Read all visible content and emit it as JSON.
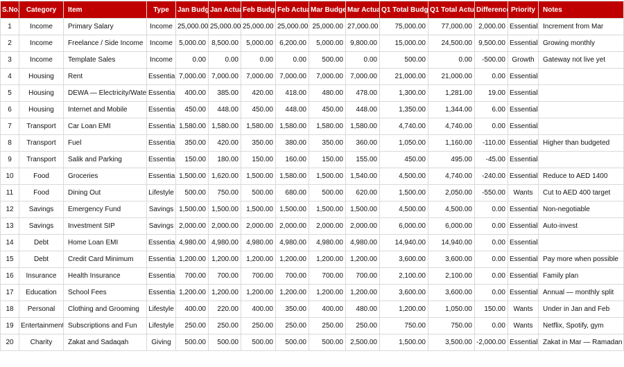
{
  "colors": {
    "header_bg": "#c00000",
    "header_text": "#ffffff",
    "grid": "#d9d9d9"
  },
  "columns": [
    {
      "key": "sno",
      "label": "S.No.",
      "align": "c"
    },
    {
      "key": "category",
      "label": "Category",
      "align": "c"
    },
    {
      "key": "item",
      "label": "Item",
      "align": "l"
    },
    {
      "key": "type",
      "label": "Type",
      "align": "c"
    },
    {
      "key": "jan_budget",
      "label": "Jan Budget",
      "align": "r"
    },
    {
      "key": "jan_actual",
      "label": "Jan Actual",
      "align": "r"
    },
    {
      "key": "feb_budget",
      "label": "Feb Budget",
      "align": "r"
    },
    {
      "key": "feb_actual",
      "label": "Feb Actual",
      "align": "r"
    },
    {
      "key": "mar_budget",
      "label": "Mar Budget",
      "align": "r"
    },
    {
      "key": "mar_actual",
      "label": "Mar Actual",
      "align": "r"
    },
    {
      "key": "q1_budget",
      "label": "Q1 Total Budget",
      "align": "r"
    },
    {
      "key": "q1_actual",
      "label": "Q1 Total Actual",
      "align": "r"
    },
    {
      "key": "difference",
      "label": "Difference",
      "align": "r"
    },
    {
      "key": "priority",
      "label": "Priority",
      "align": "c"
    },
    {
      "key": "notes",
      "label": "Notes",
      "align": "l"
    }
  ],
  "rows": [
    [
      "1",
      "Income",
      "Primary Salary",
      "Income",
      "25,000.00",
      "25,000.00",
      "25,000.00",
      "25,000.00",
      "25,000.00",
      "27,000.00",
      "75,000.00",
      "77,000.00",
      "2,000.00",
      "Essential",
      "Increment from Mar"
    ],
    [
      "2",
      "Income",
      "Freelance / Side Income",
      "Income",
      "5,000.00",
      "8,500.00",
      "5,000.00",
      "6,200.00",
      "5,000.00",
      "9,800.00",
      "15,000.00",
      "24,500.00",
      "9,500.00",
      "Essential",
      "Growing monthly"
    ],
    [
      "3",
      "Income",
      "Template Sales",
      "Income",
      "0.00",
      "0.00",
      "0.00",
      "0.00",
      "500.00",
      "0.00",
      "500.00",
      "0.00",
      "-500.00",
      "Growth",
      "Gateway not live yet"
    ],
    [
      "4",
      "Housing",
      "Rent",
      "Essential",
      "7,000.00",
      "7,000.00",
      "7,000.00",
      "7,000.00",
      "7,000.00",
      "7,000.00",
      "21,000.00",
      "21,000.00",
      "0.00",
      "Essential",
      ""
    ],
    [
      "5",
      "Housing",
      "DEWA — Electricity/Water",
      "Essential",
      "400.00",
      "385.00",
      "420.00",
      "418.00",
      "480.00",
      "478.00",
      "1,300.00",
      "1,281.00",
      "19.00",
      "Essential",
      ""
    ],
    [
      "6",
      "Housing",
      "Internet and Mobile",
      "Essential",
      "450.00",
      "448.00",
      "450.00",
      "448.00",
      "450.00",
      "448.00",
      "1,350.00",
      "1,344.00",
      "6.00",
      "Essential",
      ""
    ],
    [
      "7",
      "Transport",
      "Car Loan EMI",
      "Essential",
      "1,580.00",
      "1,580.00",
      "1,580.00",
      "1,580.00",
      "1,580.00",
      "1,580.00",
      "4,740.00",
      "4,740.00",
      "0.00",
      "Essential",
      ""
    ],
    [
      "8",
      "Transport",
      "Fuel",
      "Essential",
      "350.00",
      "420.00",
      "350.00",
      "380.00",
      "350.00",
      "360.00",
      "1,050.00",
      "1,160.00",
      "-110.00",
      "Essential",
      "Higher than budgeted"
    ],
    [
      "9",
      "Transport",
      "Salik and Parking",
      "Essential",
      "150.00",
      "180.00",
      "150.00",
      "160.00",
      "150.00",
      "155.00",
      "450.00",
      "495.00",
      "-45.00",
      "Essential",
      ""
    ],
    [
      "10",
      "Food",
      "Groceries",
      "Essential",
      "1,500.00",
      "1,620.00",
      "1,500.00",
      "1,580.00",
      "1,500.00",
      "1,540.00",
      "4,500.00",
      "4,740.00",
      "-240.00",
      "Essential",
      "Reduce to AED 1400"
    ],
    [
      "11",
      "Food",
      "Dining Out",
      "Lifestyle",
      "500.00",
      "750.00",
      "500.00",
      "680.00",
      "500.00",
      "620.00",
      "1,500.00",
      "2,050.00",
      "-550.00",
      "Wants",
      "Cut to AED 400 target"
    ],
    [
      "12",
      "Savings",
      "Emergency Fund",
      "Savings",
      "1,500.00",
      "1,500.00",
      "1,500.00",
      "1,500.00",
      "1,500.00",
      "1,500.00",
      "4,500.00",
      "4,500.00",
      "0.00",
      "Essential",
      "Non-negotiable"
    ],
    [
      "13",
      "Savings",
      "Investment SIP",
      "Savings",
      "2,000.00",
      "2,000.00",
      "2,000.00",
      "2,000.00",
      "2,000.00",
      "2,000.00",
      "6,000.00",
      "6,000.00",
      "0.00",
      "Essential",
      "Auto-invest"
    ],
    [
      "14",
      "Debt",
      "Home Loan EMI",
      "Essential",
      "4,980.00",
      "4,980.00",
      "4,980.00",
      "4,980.00",
      "4,980.00",
      "4,980.00",
      "14,940.00",
      "14,940.00",
      "0.00",
      "Essential",
      ""
    ],
    [
      "15",
      "Debt",
      "Credit Card Minimum",
      "Essential",
      "1,200.00",
      "1,200.00",
      "1,200.00",
      "1,200.00",
      "1,200.00",
      "1,200.00",
      "3,600.00",
      "3,600.00",
      "0.00",
      "Essential",
      "Pay more when possible"
    ],
    [
      "16",
      "Insurance",
      "Health Insurance",
      "Essential",
      "700.00",
      "700.00",
      "700.00",
      "700.00",
      "700.00",
      "700.00",
      "2,100.00",
      "2,100.00",
      "0.00",
      "Essential",
      "Family plan"
    ],
    [
      "17",
      "Education",
      "School Fees",
      "Essential",
      "1,200.00",
      "1,200.00",
      "1,200.00",
      "1,200.00",
      "1,200.00",
      "1,200.00",
      "3,600.00",
      "3,600.00",
      "0.00",
      "Essential",
      "Annual — monthly split"
    ],
    [
      "18",
      "Personal",
      "Clothing and Grooming",
      "Lifestyle",
      "400.00",
      "220.00",
      "400.00",
      "350.00",
      "400.00",
      "480.00",
      "1,200.00",
      "1,050.00",
      "150.00",
      "Wants",
      "Under in Jan and Feb"
    ],
    [
      "19",
      "Entertainment",
      "Subscriptions and Fun",
      "Lifestyle",
      "250.00",
      "250.00",
      "250.00",
      "250.00",
      "250.00",
      "250.00",
      "750.00",
      "750.00",
      "0.00",
      "Wants",
      "Netflix, Spotify, gym"
    ],
    [
      "20",
      "Charity",
      "Zakat and Sadaqah",
      "Giving",
      "500.00",
      "500.00",
      "500.00",
      "500.00",
      "500.00",
      "2,500.00",
      "1,500.00",
      "3,500.00",
      "-2,000.00",
      "Essential",
      "Zakat in Mar — Ramadan"
    ]
  ]
}
